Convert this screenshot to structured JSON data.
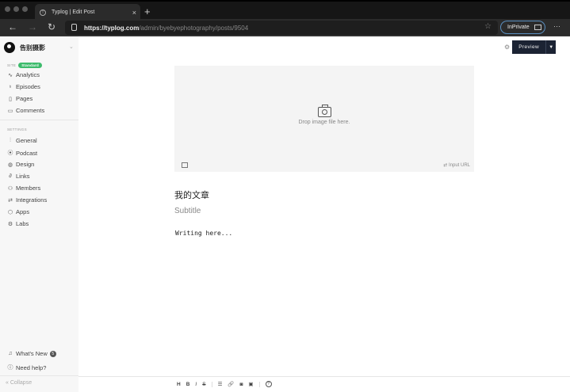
{
  "browser": {
    "tab_title": "Typlog | Edit Post",
    "url_host": "https://typlog.com",
    "url_path": "/admin/byebyephotography/posts/9504",
    "inprivate": "InPrivate"
  },
  "sidebar": {
    "site_name": "告别摄影",
    "site_label": "SITE",
    "plan_badge": "Standard",
    "site_items": [
      {
        "label": "Analytics",
        "icon": "analytics-icon"
      },
      {
        "label": "Episodes",
        "icon": "microphone-icon"
      },
      {
        "label": "Pages",
        "icon": "page-icon"
      },
      {
        "label": "Comments",
        "icon": "comment-icon"
      }
    ],
    "settings_label": "SETTINGS",
    "settings_items": [
      {
        "label": "General",
        "icon": "sliders-icon"
      },
      {
        "label": "Podcast",
        "icon": "podcast-icon"
      },
      {
        "label": "Design",
        "icon": "palette-icon"
      },
      {
        "label": "Links",
        "icon": "link-icon"
      },
      {
        "label": "Members",
        "icon": "members-icon"
      },
      {
        "label": "Integrations",
        "icon": "integrations-icon"
      },
      {
        "label": "Apps",
        "icon": "apps-icon"
      },
      {
        "label": "Labs",
        "icon": "labs-icon"
      }
    ],
    "whats_new": "What's New",
    "whats_new_count": "5",
    "need_help": "Need help?",
    "collapse": "Collapse"
  },
  "header": {
    "preview": "Preview"
  },
  "editor": {
    "drop_text": "Drop image file here.",
    "input_url": "Input URL",
    "title": "我的文章",
    "subtitle_placeholder": "Subtitle",
    "body_placeholder": "Writing here..."
  },
  "toolbar": {
    "heading": "H",
    "bold": "B",
    "italic": "I",
    "strike": "S",
    "list": "☰",
    "link": "🔗",
    "camera": "◙",
    "image": "▣",
    "help": "?"
  }
}
